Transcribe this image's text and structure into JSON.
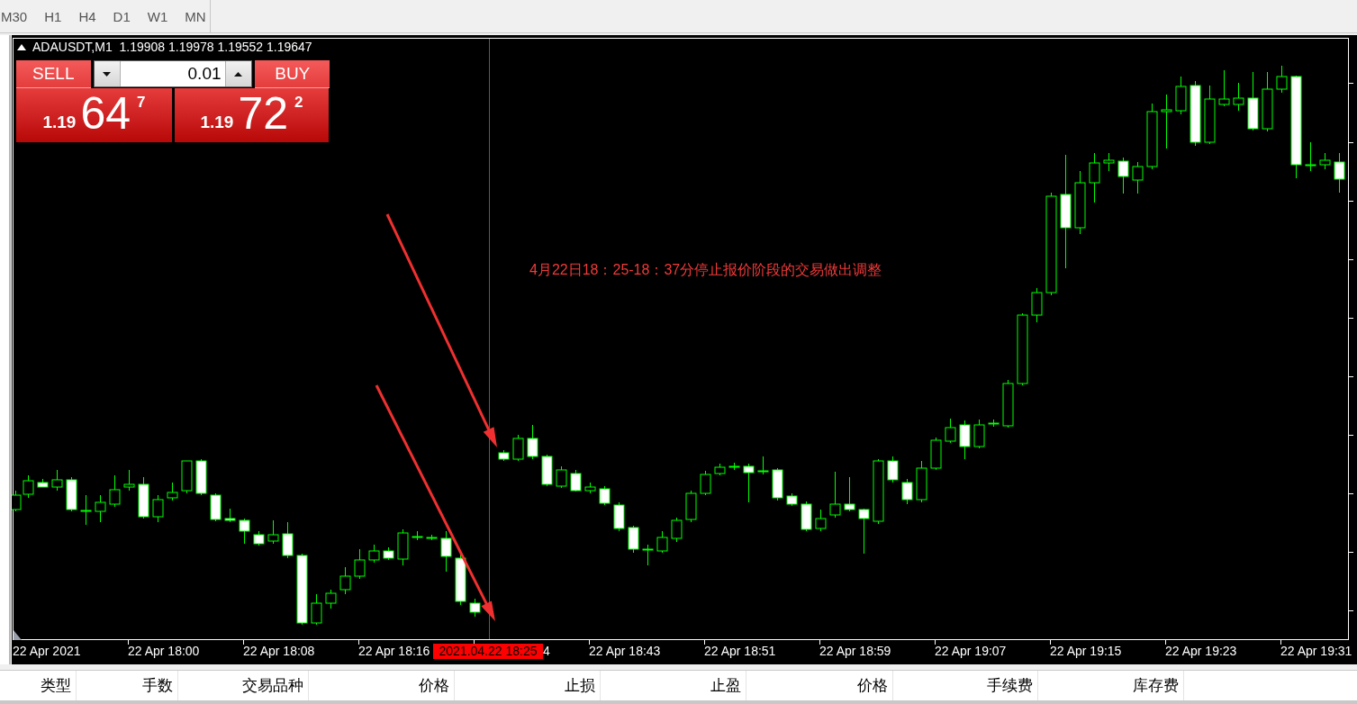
{
  "toolbar": {
    "timeframes": [
      "M30",
      "H1",
      "H4",
      "D1",
      "W1",
      "MN"
    ]
  },
  "chart": {
    "title": "ADAUSDT,M1  1.19908 1.19978 1.19552 1.19647",
    "trade_panel": {
      "sell": {
        "label": "SELL",
        "price_prefix": "1.19",
        "price_main": "64",
        "price_sup": "7"
      },
      "volume": "0.01",
      "buy": {
        "label": "BUY",
        "price_prefix": "1.19",
        "price_main": "72",
        "price_sup": "2"
      }
    },
    "annotation": "4月22日18：25-18：37分停止报价阶段的交易做出调整",
    "time_axis": [
      "22 Apr 2021",
      "22 Apr 18:00",
      "22 Apr 18:08",
      "22 Apr 18:16",
      "4",
      "22 Apr 18:43",
      "22 Apr 18:51",
      "22 Apr 18:59",
      "22 Apr 19:07",
      "22 Apr 19:15",
      "22 Apr 19:23",
      "22 Apr 19:31"
    ],
    "cursor_time": "2021.04.22 18:25"
  },
  "trade_table": {
    "columns": [
      "类型",
      "手数",
      "交易品种",
      "价格",
      "止损",
      "止盈",
      "价格",
      "手续费",
      "库存费"
    ]
  }
}
